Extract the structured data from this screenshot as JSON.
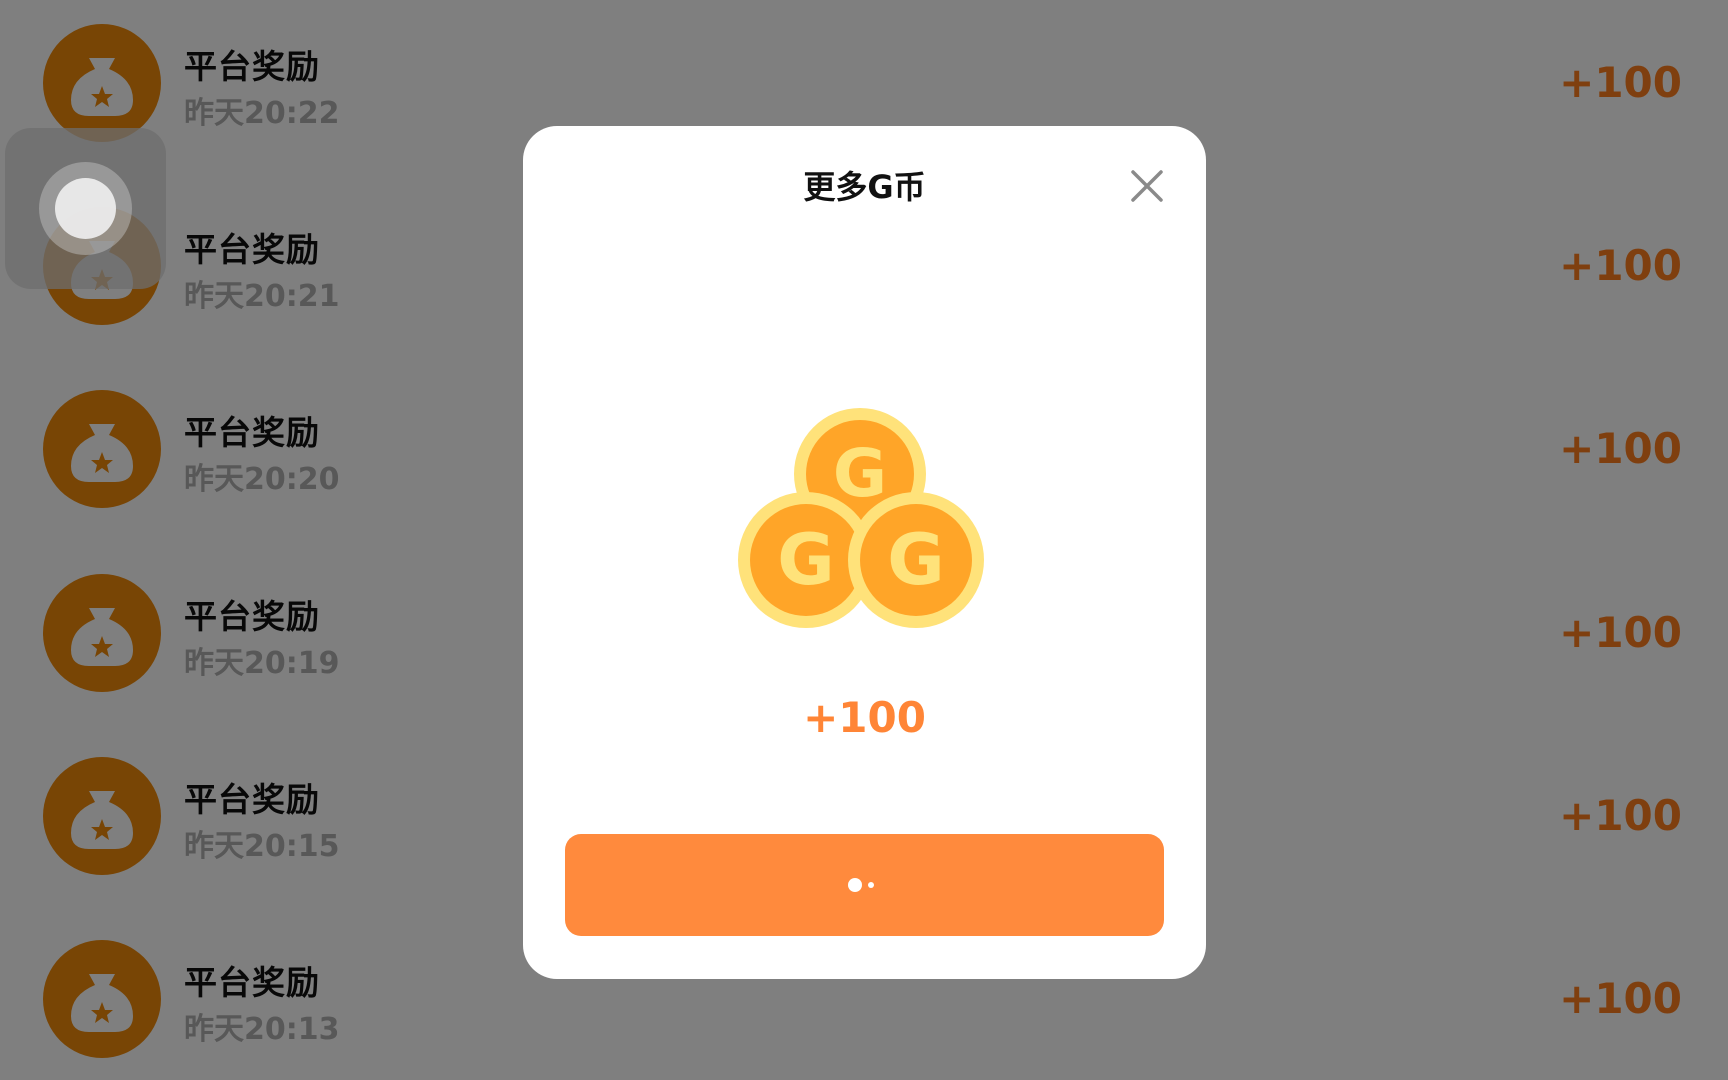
{
  "list": {
    "items": [
      {
        "title": "平台奖励",
        "time": "昨天20:22",
        "amount": "+100"
      },
      {
        "title": "平台奖励",
        "time": "昨天20:21",
        "amount": "+100"
      },
      {
        "title": "平台奖励",
        "time": "昨天20:20",
        "amount": "+100"
      },
      {
        "title": "平台奖励",
        "time": "昨天20:19",
        "amount": "+100"
      },
      {
        "title": "平台奖励",
        "time": "昨天20:15",
        "amount": "+100"
      },
      {
        "title": "平台奖励",
        "time": "昨天20:13",
        "amount": "+100"
      }
    ]
  },
  "modal": {
    "title": "更多G币",
    "reward": "+100",
    "icon": "coins-icon",
    "close_icon": "close-icon",
    "button_state": "loading"
  },
  "colors": {
    "accent": "#ff8a3d",
    "avatar": "#f08a0a",
    "amount": "#ff7f1e",
    "coin_outer": "#ffe27a",
    "coin_inner": "#ffa528"
  }
}
